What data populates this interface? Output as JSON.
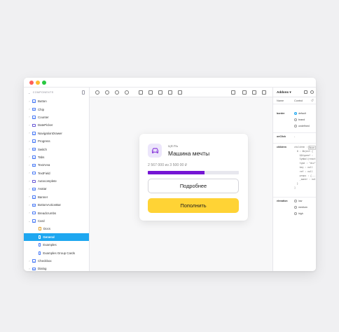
{
  "sidebar": {
    "header": "COMPONENTS",
    "items": [
      {
        "label": "Button",
        "icon": "component-icon",
        "kind": "comp"
      },
      {
        "label": "Chip",
        "icon": "component-icon",
        "kind": "comp"
      },
      {
        "label": "Counter",
        "icon": "component-icon",
        "kind": "comp"
      },
      {
        "label": "DatePicker",
        "icon": "folder-icon",
        "kind": "folder"
      },
      {
        "label": "NavigationDrawer",
        "icon": "component-icon",
        "kind": "comp"
      },
      {
        "label": "Progress",
        "icon": "component-icon",
        "kind": "comp"
      },
      {
        "label": "Switch",
        "icon": "component-icon",
        "kind": "comp"
      },
      {
        "label": "Tabs",
        "icon": "component-icon",
        "kind": "comp"
      },
      {
        "label": "TextArea",
        "icon": "component-icon",
        "kind": "comp"
      },
      {
        "label": "TextField",
        "icon": "component-icon",
        "kind": "comp"
      },
      {
        "label": "Autocomplete",
        "icon": "folder-icon",
        "kind": "folder"
      },
      {
        "label": "Avatar",
        "icon": "component-icon",
        "kind": "comp"
      },
      {
        "label": "Banner",
        "icon": "component-icon",
        "kind": "comp"
      },
      {
        "label": "BottomActionBar",
        "icon": "component-icon",
        "kind": "comp"
      },
      {
        "label": "Breadcrumbs",
        "icon": "component-icon",
        "kind": "comp"
      },
      {
        "label": "Card",
        "icon": "component-icon",
        "kind": "comp",
        "expanded": true
      },
      {
        "label": "Docs",
        "icon": "doc-icon",
        "kind": "doc",
        "child": true
      },
      {
        "label": "General",
        "icon": "story-icon",
        "kind": "story",
        "child": true,
        "selected": true
      },
      {
        "label": "Examples",
        "icon": "story-icon",
        "kind": "story",
        "child": true
      },
      {
        "label": "Examples Group Cards",
        "icon": "story-icon",
        "kind": "story",
        "child": true
      },
      {
        "label": "Checkbox",
        "icon": "component-icon",
        "kind": "comp"
      },
      {
        "label": "Dialog",
        "icon": "component-icon",
        "kind": "comp"
      }
    ]
  },
  "card": {
    "label": "ЦЕЛЬ",
    "title": "Машина мечты",
    "amount": "2 567 000 из 3 500 00 ₽",
    "progress": 0.62,
    "secondary_button": "Подробнее",
    "primary_button": "Пополнить",
    "icon": "car-icon",
    "colors": {
      "accent": "#7515d4",
      "icon_bg": "#ece6fb",
      "primary": "#ffd335"
    }
  },
  "panel": {
    "tab": "Addons",
    "columns": {
      "name": "Name",
      "control": "Control"
    },
    "border": {
      "label": "border",
      "options": [
        "default",
        "brand",
        "undefined"
      ],
      "selected": "default"
    },
    "onclick": {
      "label": "onClick",
      "value": "-"
    },
    "children": {
      "label": "children",
      "tag": "RAW",
      "lines": [
        "children : [",
        "  0 : Object {",
        "    $$typeof : ",
        "    Symbol(react.element)",
        "    type : \"div\"",
        "    key : null",
        "    ref : null",
        "    props : {...} 1 key",
        "    _owner : null",
        "  }",
        "]"
      ]
    },
    "elevation": {
      "label": "elevation",
      "options": [
        "low",
        "medium",
        "high"
      ]
    }
  }
}
